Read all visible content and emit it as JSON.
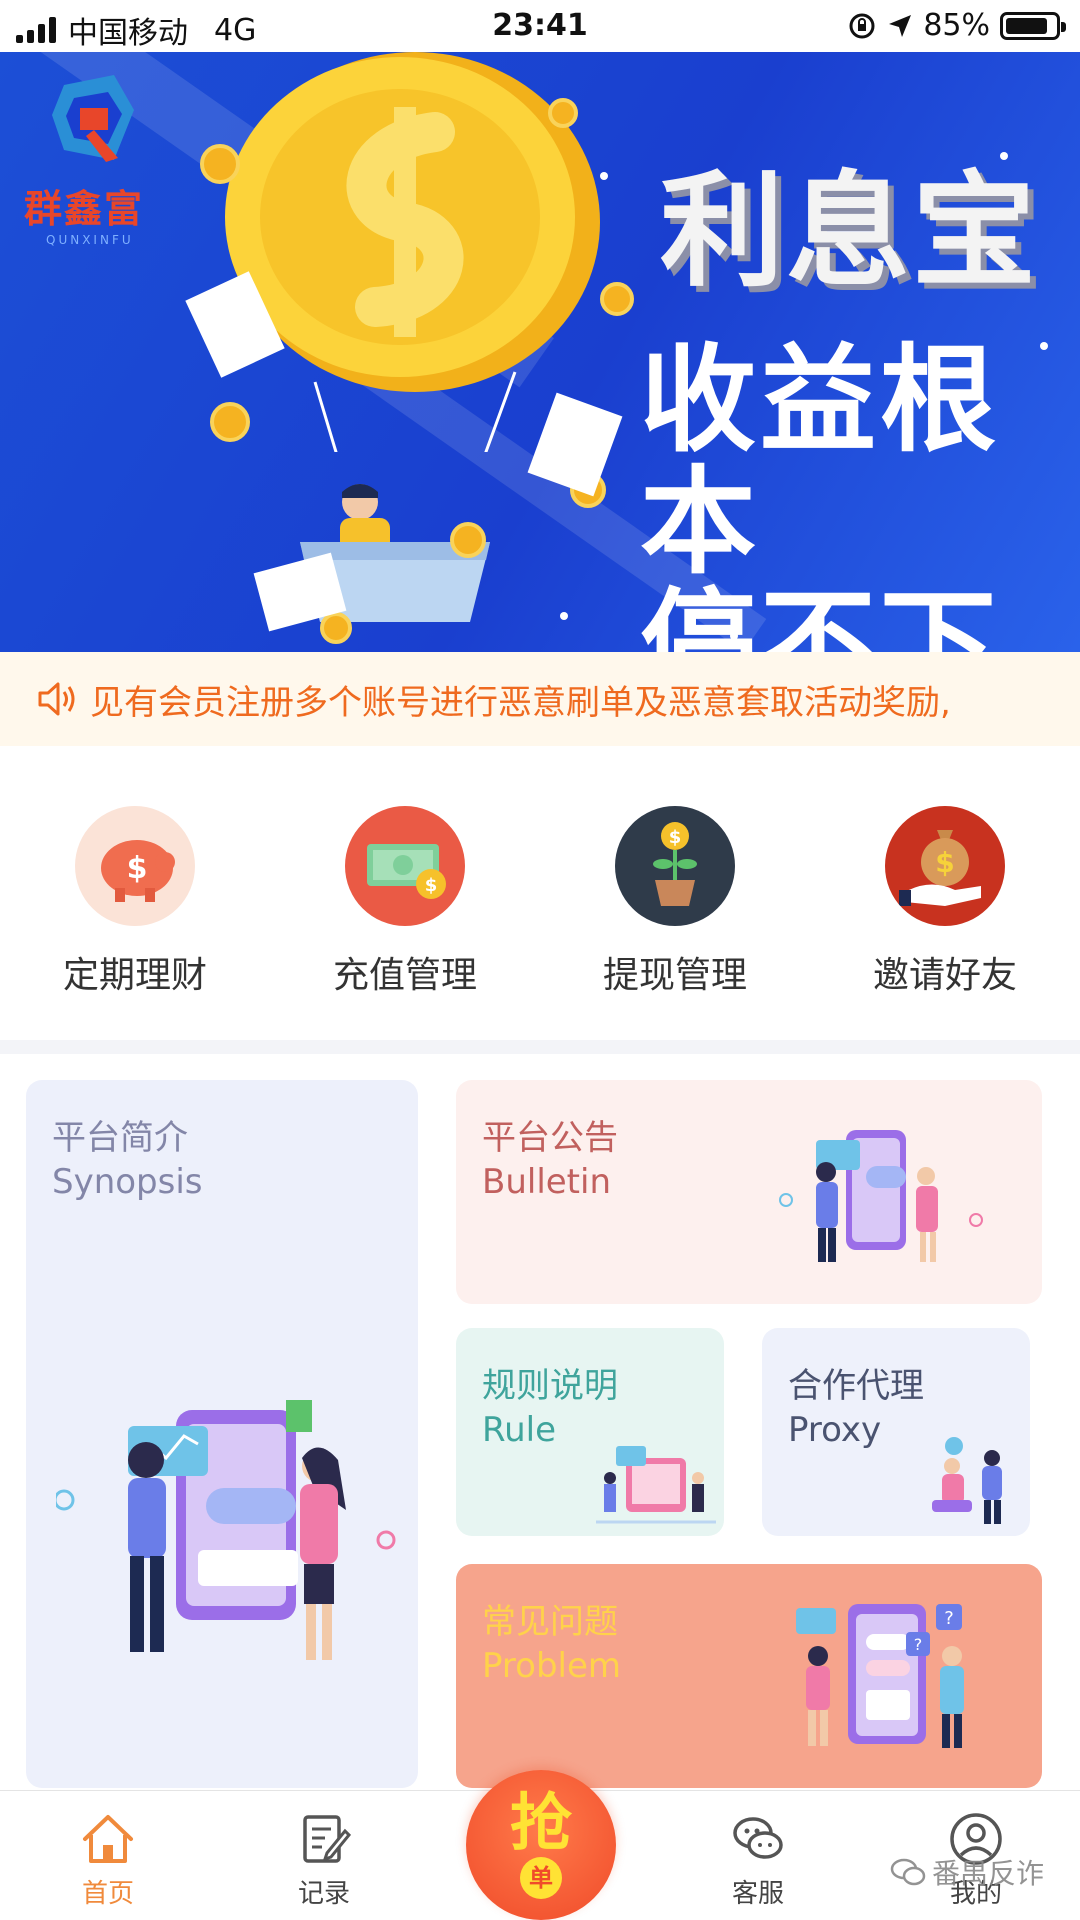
{
  "status_bar": {
    "carrier": "中国移动",
    "network": "4G",
    "time": "23:41",
    "battery_percent": "85%",
    "battery_level": 0.85
  },
  "banner": {
    "logo_text": "群鑫富",
    "logo_sub": "QUNXINFU",
    "headline_1": "利息宝",
    "headline_2": "收益根本",
    "headline_3": "停不下来"
  },
  "notice": {
    "icon": "speaker-icon",
    "text": "见有会员注册多个账号进行恶意刷单及恶意套取活动奖励,"
  },
  "quick_actions": [
    {
      "label": "定期理财",
      "icon": "piggy-bank-icon",
      "color": "#f06d4f"
    },
    {
      "label": "充值管理",
      "icon": "money-icon",
      "color": "#ea5a45"
    },
    {
      "label": "提现管理",
      "icon": "plant-coin-icon",
      "color": "#2f3b4a"
    },
    {
      "label": "邀请好友",
      "icon": "money-bag-hand-icon",
      "color": "#c8321f"
    }
  ],
  "cards": {
    "synopsis": {
      "cn": "平台简介",
      "en": "Synopsis"
    },
    "bulletin": {
      "cn": "平台公告",
      "en": "Bulletin"
    },
    "rule": {
      "cn": "规则说明",
      "en": "Rule"
    },
    "proxy": {
      "cn": "合作代理",
      "en": "Proxy"
    },
    "problem": {
      "cn": "常见问题",
      "en": "Problem"
    }
  },
  "tabbar": {
    "home": "首页",
    "records": "记录",
    "grab_main": "抢",
    "grab_sub": "单",
    "service": "客服",
    "mine": "我的",
    "active_color": "#f08a3c"
  },
  "watermark": "番禺反诈"
}
